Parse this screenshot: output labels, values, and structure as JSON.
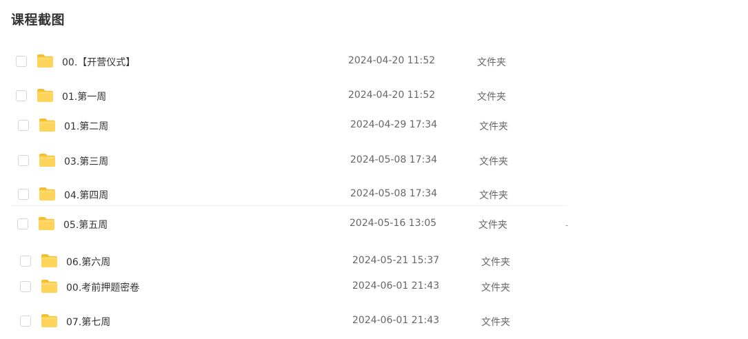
{
  "page": {
    "title": "课程截图"
  },
  "colors": {
    "folder_body": "#ffd45a",
    "folder_tab": "#f6bd2a",
    "folder_shadow": "#ffc83a"
  },
  "icons": {
    "folder": "folder-icon",
    "checkbox": "checkbox"
  },
  "files": [
    {
      "name": "00.【开营仪式】",
      "date": "2024-04-20 11:52",
      "type": "文件夹"
    },
    {
      "name": "01.第一周",
      "date": "2024-04-20 11:52",
      "type": "文件夹"
    },
    {
      "name": "01.第二周",
      "date": "2024-04-29 17:34",
      "type": "文件夹"
    },
    {
      "name": "03.第三周",
      "date": "2024-05-08 17:34",
      "type": "文件夹"
    },
    {
      "name": "04.第四周",
      "date": "2024-05-08 17:34",
      "type": "文件夹"
    },
    {
      "name": "05.第五周",
      "date": "2024-05-16 13:05",
      "type": "文件夹"
    },
    {
      "name": "06.第六周",
      "date": "2024-05-21 15:37",
      "type": "文件夹"
    },
    {
      "name": "00.考前押题密卷",
      "date": "2024-06-01 21:43",
      "type": "文件夹"
    },
    {
      "name": "07.第七周",
      "date": "2024-06-01 21:43",
      "type": "文件夹"
    }
  ],
  "stray_mark": "-"
}
